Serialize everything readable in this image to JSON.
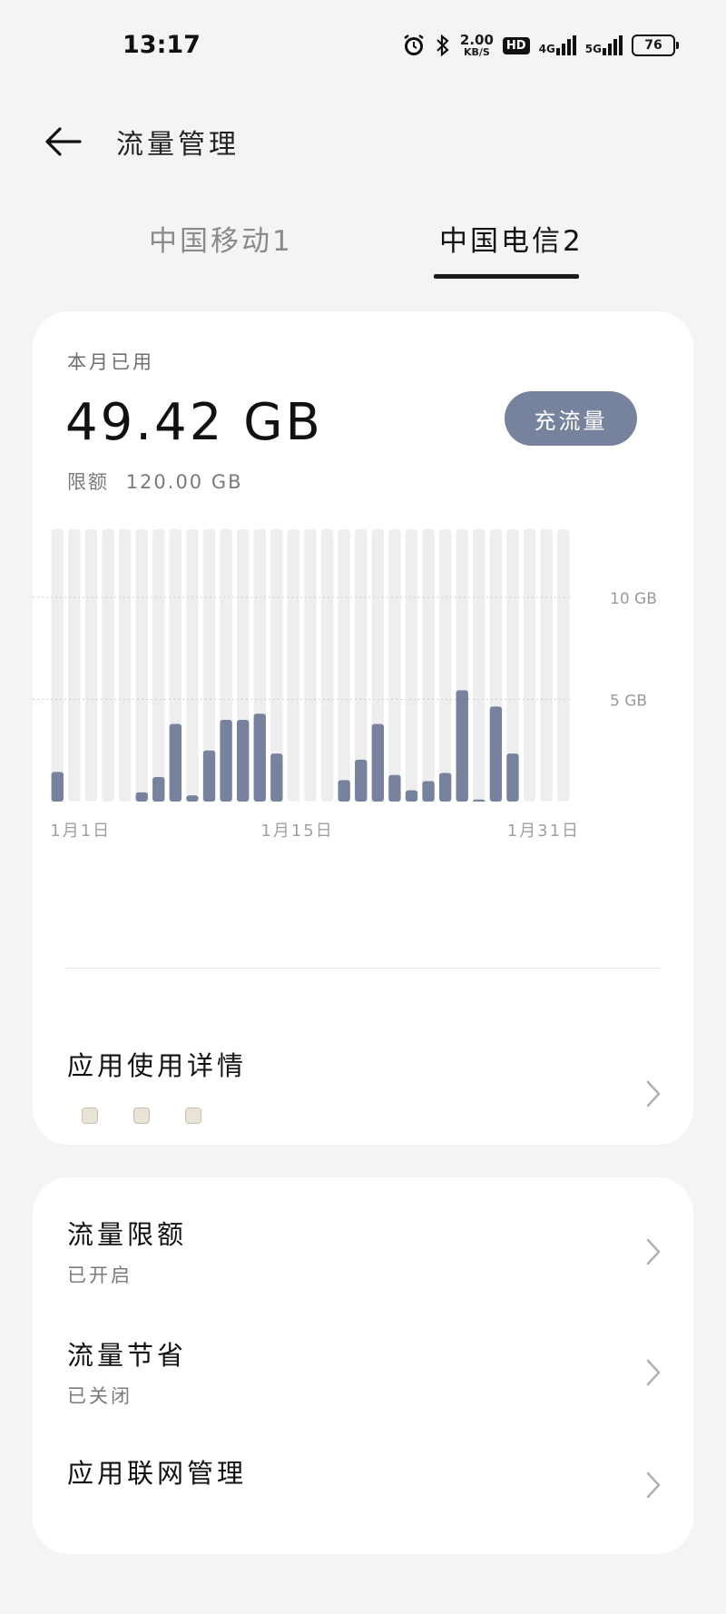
{
  "status_bar": {
    "time": "13:17",
    "speed_value": "2.00",
    "speed_unit": "KB/S",
    "hd_label": "HD",
    "net1_label": "4G",
    "net2_label": "5G",
    "battery": "76"
  },
  "header": {
    "title": "流量管理"
  },
  "tabs": [
    {
      "label": "中国移动1",
      "selected": false
    },
    {
      "label": "中国电信2",
      "selected": true
    }
  ],
  "usage": {
    "label": "本月已用",
    "value": "49.42 GB",
    "limit_label": "限额",
    "limit_value": "120.00 GB",
    "recharge_button": "充流量"
  },
  "chart_data": {
    "type": "bar",
    "categories": [
      "1",
      "2",
      "3",
      "4",
      "5",
      "6",
      "7",
      "8",
      "9",
      "10",
      "11",
      "12",
      "13",
      "14",
      "15",
      "16",
      "17",
      "18",
      "19",
      "20",
      "21",
      "22",
      "23",
      "24",
      "25",
      "26",
      "27",
      "28",
      "29",
      "30",
      "31"
    ],
    "values": [
      1.45,
      0,
      0,
      0,
      0,
      0.45,
      1.2,
      3.8,
      0.3,
      2.5,
      4.0,
      4.0,
      4.3,
      2.35,
      0,
      0,
      0,
      1.05,
      2.05,
      3.8,
      1.3,
      0.55,
      1.0,
      1.4,
      5.45,
      0.1,
      4.65,
      2.35,
      0,
      0,
      0
    ],
    "ylim": [
      0,
      13
    ],
    "y_ticks": [
      {
        "value": 10,
        "label": "10 GB"
      },
      {
        "value": 5,
        "label": "5 GB"
      }
    ],
    "x_labels": [
      "1月1日",
      "1月15日",
      "1月31日"
    ],
    "bar_color": "#77839d",
    "track_color": "#eeeeee",
    "ylabel": "",
    "xlabel": ""
  },
  "app_usage": {
    "title": "应用使用详情"
  },
  "settings": [
    {
      "title": "流量限额",
      "subtitle": "已开启"
    },
    {
      "title": "流量节省",
      "subtitle": "已关闭"
    },
    {
      "title": "应用联网管理",
      "subtitle": ""
    }
  ],
  "colors": {
    "accent": "#77839d",
    "background": "#f4f4f4",
    "card": "#ffffff"
  }
}
